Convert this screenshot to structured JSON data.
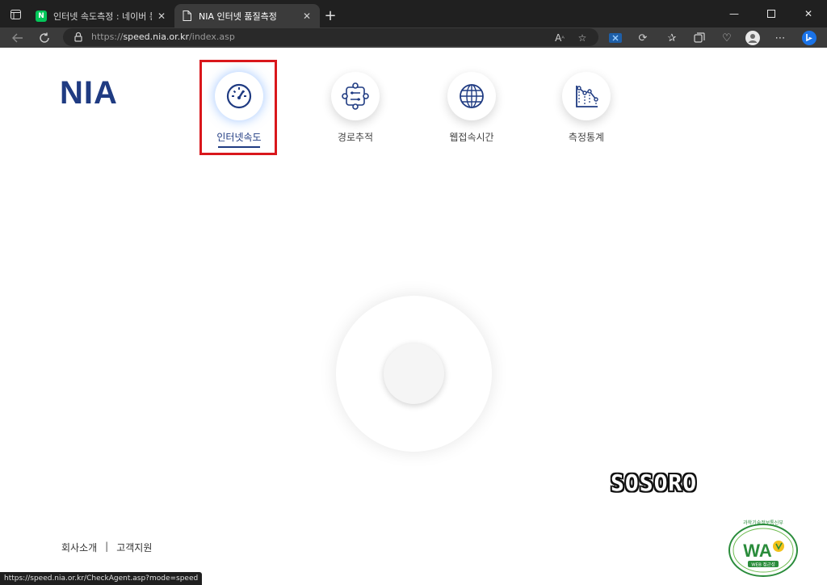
{
  "browser": {
    "tabs": [
      {
        "title": "인터넷 속도측정 : 네이버 통합검",
        "favicon": "naver-icon"
      },
      {
        "title": "NIA 인터넷 품질측정",
        "favicon": "page-icon"
      }
    ],
    "address": {
      "scheme": "https://",
      "host": "speed.nia.or.kr",
      "path": "/index.asp"
    },
    "status_url": "https://speed.nia.or.kr/CheckAgent.asp?mode=speed"
  },
  "page": {
    "logo": "NIA",
    "nav": [
      {
        "label": "인터넷속도",
        "icon": "speedometer-icon",
        "active": true
      },
      {
        "label": "경로추적",
        "icon": "route-trace-icon",
        "active": false
      },
      {
        "label": "웹접속시간",
        "icon": "globe-icon",
        "active": false
      },
      {
        "label": "측정통계",
        "icon": "statistics-icon",
        "active": false
      }
    ],
    "watermark": "SOSORO",
    "footer": {
      "about": "회사소개",
      "separator": "|",
      "support": "고객지원"
    },
    "badge": {
      "top_text": "과학기술정보통신부",
      "logo_text": "WA",
      "caption": "WEB 접근성"
    }
  },
  "colors": {
    "brand": "#1f3b82",
    "highlight": "#d9171c",
    "naver": "#03c75a"
  }
}
